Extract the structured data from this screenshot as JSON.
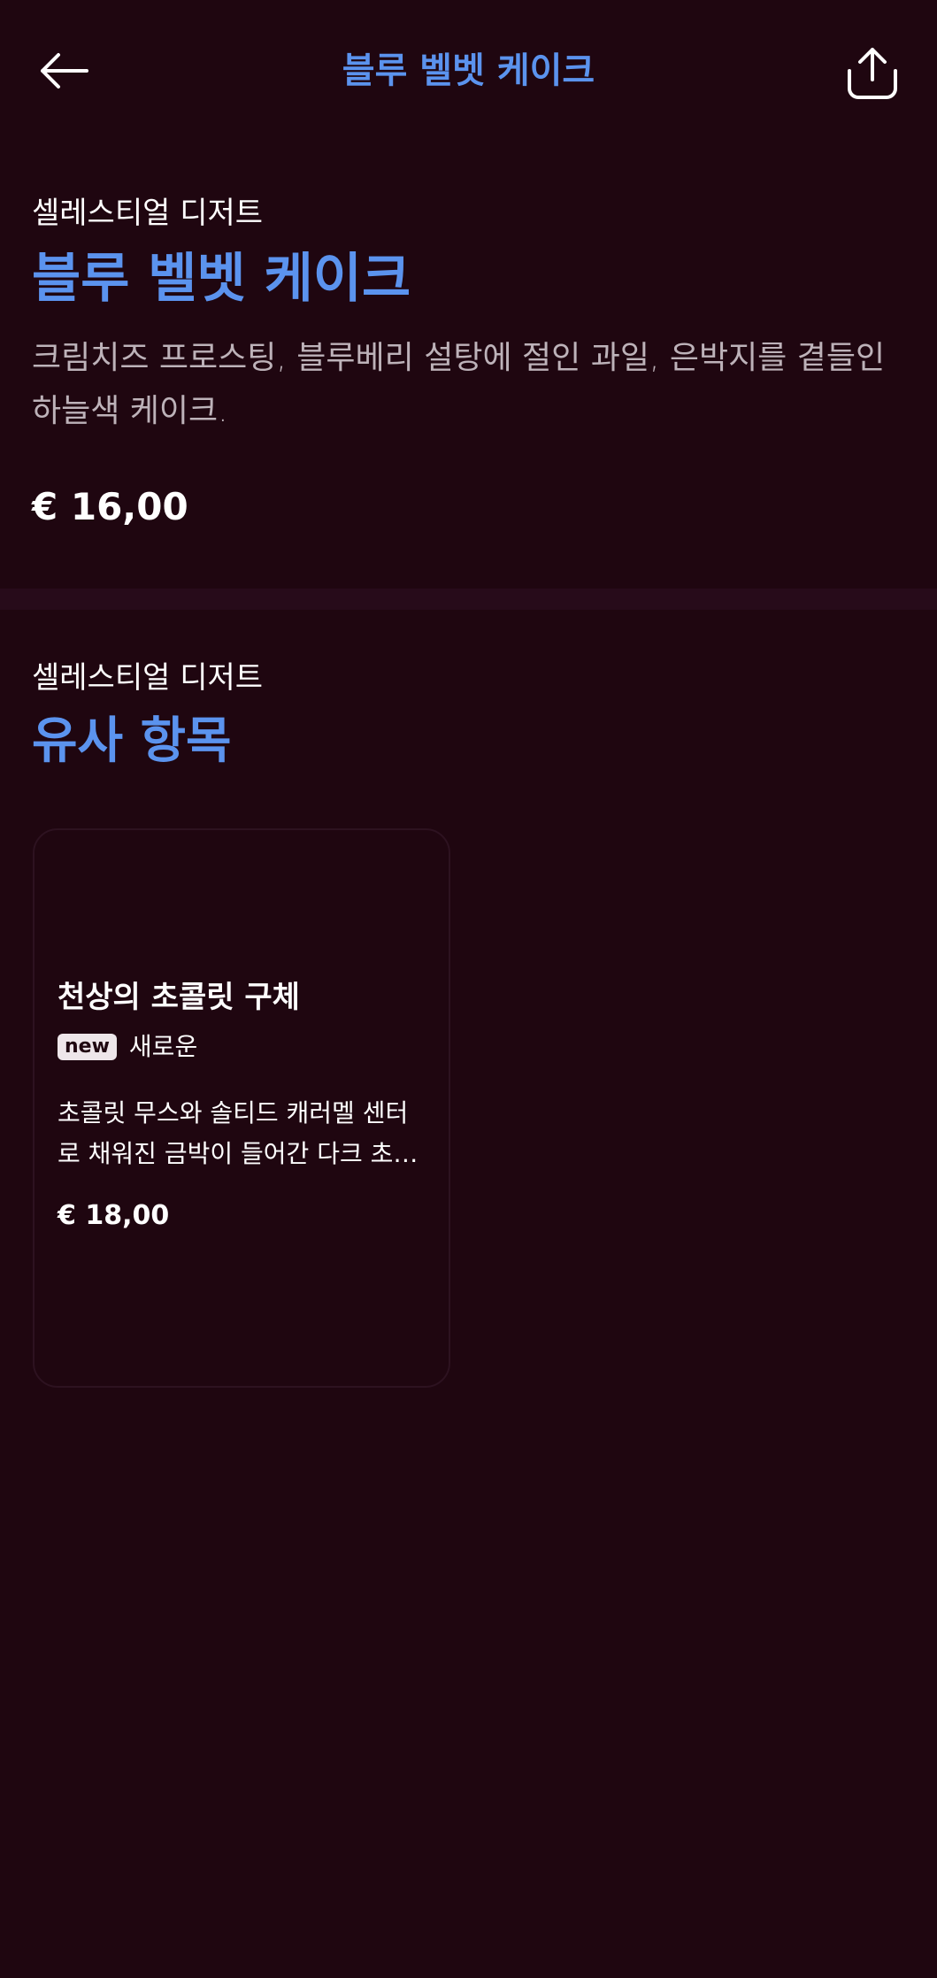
{
  "header": {
    "title": "블루 벨벳 케이크",
    "back_icon": "arrow-left-icon",
    "share_icon": "share-icon"
  },
  "product": {
    "category": "셀레스티얼 디저트",
    "title": "블루 벨벳 케이크",
    "description": "크림치즈 프로스팅, 블루베리 설탕에 절인 과일, 은박지를 곁들인 하늘색 케이크.",
    "price": "€ 16,00"
  },
  "similar": {
    "category": "셀레스티얼 디저트",
    "title": "유사 항목",
    "items": [
      {
        "title": "천상의 초콜릿 구체",
        "badge": "new",
        "tag": "새로운",
        "description": "초콜릿 무스와 솔티드 캐러멜 센터로 채워진 금박이 들어간 다크 초콜릿 구체",
        "price": "€ 18,00"
      }
    ]
  },
  "colors": {
    "background": "#1f0610",
    "accent": "#5b93ee",
    "divider": "#270b1a"
  }
}
